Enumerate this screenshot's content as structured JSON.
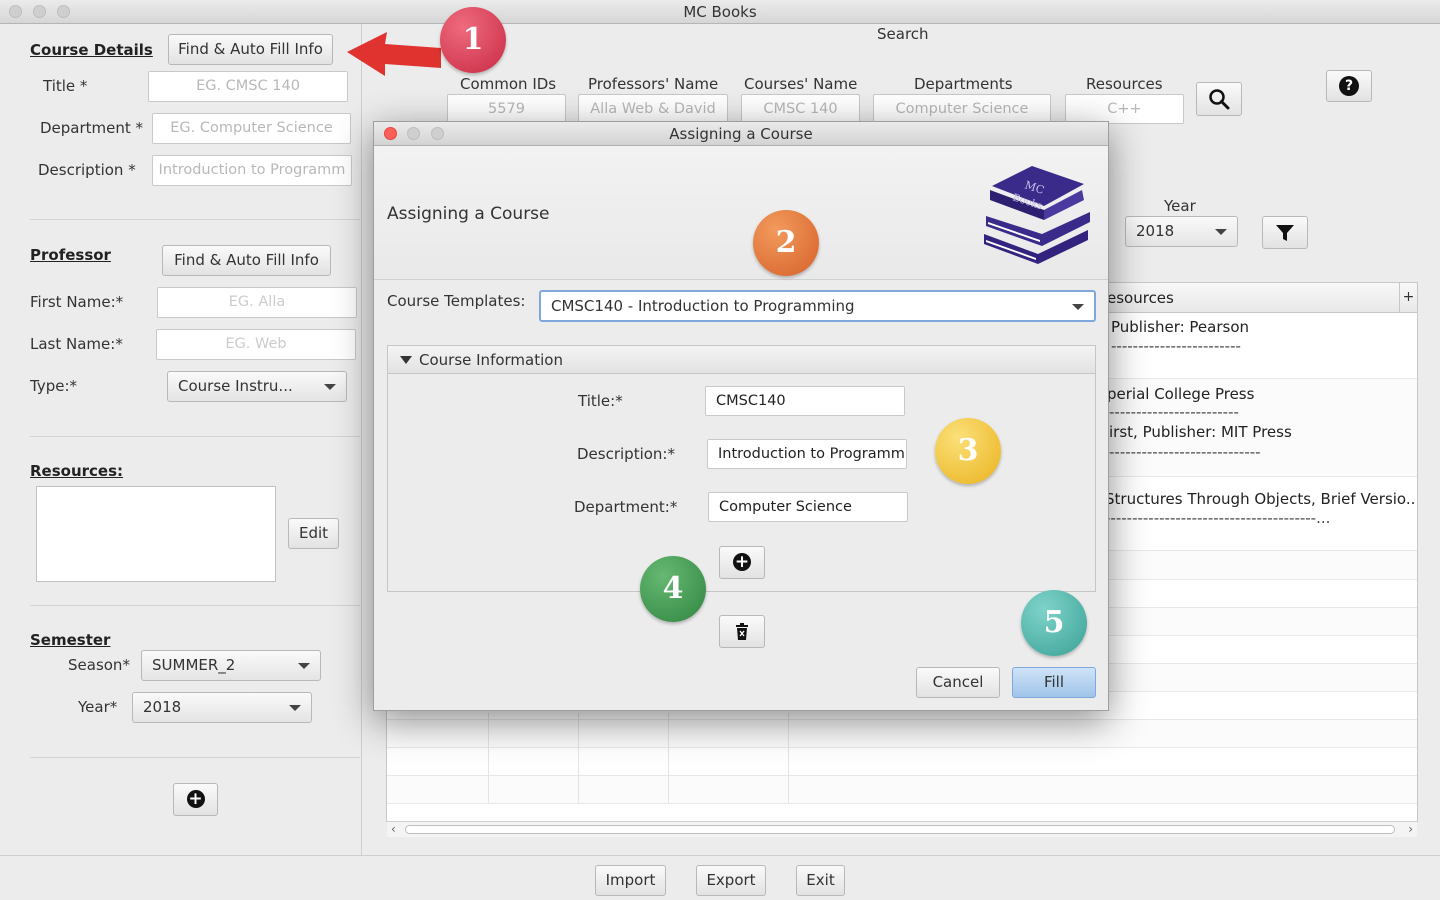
{
  "window": {
    "title": "MC Books"
  },
  "left": {
    "course_details": {
      "heading": "Course Details",
      "autofill_label": "Find & Auto Fill Info",
      "title_label": "Title *",
      "title_placeholder": "EG. CMSC 140",
      "department_label": "Department *",
      "department_placeholder": "EG.  Computer Science",
      "description_label": "Description *",
      "description_placeholder": "Introduction to Programm"
    },
    "professor": {
      "heading": "Professor",
      "autofill_label": "Find & Auto Fill Info",
      "first_label": "First Name:*",
      "first_placeholder": "EG. Alla",
      "last_label": "Last Name:*",
      "last_placeholder": "EG. Web",
      "type_label": "Type:*",
      "type_value": "Course Instru..."
    },
    "resources": {
      "heading": "Resources:",
      "edit_label": "Edit"
    },
    "semester": {
      "heading": "Semester",
      "season_label": "Season*",
      "season_value": "SUMMER_2",
      "year_label": "Year*",
      "year_value": "2018"
    }
  },
  "search": {
    "heading": "Search",
    "columns": [
      {
        "label": "Common IDs",
        "placeholder": "5579"
      },
      {
        "label": "Professors' Name",
        "placeholder": "Alla Web & David"
      },
      {
        "label": "Courses' Name",
        "placeholder": "CMSC 140"
      },
      {
        "label": "Departments",
        "placeholder": "Computer Science"
      },
      {
        "label": "Resources",
        "placeholder": "C++"
      }
    ],
    "year_label": "Year",
    "year_value": "2018"
  },
  "table": {
    "resources_header": "esources",
    "plus_header": "+",
    "lines": [
      "Publisher: Pearson",
      "------------------------",
      "perial College Press",
      "------------------------",
      "irst, Publisher: MIT Press",
      "----------------------------",
      "Structures Through Objects, Brief Versio...",
      "---------------------------------------..."
    ]
  },
  "bottom": {
    "import": "Import",
    "export": "Export",
    "exit": "Exit"
  },
  "dialog": {
    "window_title": "Assigning a Course",
    "header": "Assigning a Course",
    "logo_text_1": "MC",
    "logo_text_2": "Books",
    "templates_label": "Course Templates:",
    "templates_value": "CMSC140 - Introduction to Programming",
    "section_title": "Course Information",
    "title_label": "Title:*",
    "title_value": "CMSC140",
    "description_label": "Description:*",
    "description_value": "Introduction to Programm",
    "department_label": "Department:*",
    "department_value": "Computer Science",
    "cancel": "Cancel",
    "fill": "Fill"
  },
  "annotations": {
    "badges": [
      "1",
      "2",
      "3",
      "4",
      "5"
    ],
    "colors": {
      "one": "#d63a52",
      "two": "#e6783a",
      "three": "#f3c234",
      "four": "#3f9a4f",
      "five": "#4cb3a8",
      "arrow": "#e0322e"
    }
  }
}
